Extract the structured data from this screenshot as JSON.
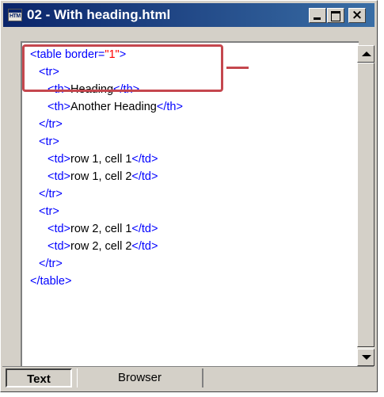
{
  "window": {
    "title": "02 - With heading.html",
    "icon_text": "HTM",
    "icon": "html-file-icon",
    "controls": [
      "minimize-icon",
      "maximize-icon",
      "close-icon"
    ]
  },
  "colors": {
    "titlebar": "#0a246a",
    "tag": "#0000ff",
    "attribute_value": "#ff0000",
    "highlight": "#c5474e"
  },
  "code": {
    "line1": {
      "tag": "<table border=",
      "attr": "\"1\"",
      "end": ">"
    },
    "line2": {
      "tag": "<tr>"
    },
    "line3": {
      "open": "<th>",
      "text": "Heading",
      "close": "</th>"
    },
    "line4": {
      "open": "<th>",
      "text": "Another Heading",
      "close": "</th>"
    },
    "line5": {
      "tag": "</tr>"
    },
    "line6": {
      "tag": "<tr>"
    },
    "line7": {
      "open": "<td>",
      "text": "row 1, cell 1",
      "close": "</td>"
    },
    "line8": {
      "open": "<td>",
      "text": "row 1, cell 2",
      "close": "</td>"
    },
    "line9": {
      "tag": "</tr>"
    },
    "line10": {
      "tag": "<tr>"
    },
    "line11": {
      "open": "<td>",
      "text": "row 2, cell 1",
      "close": "</td>"
    },
    "line12": {
      "open": "<td>",
      "text": "row 2, cell 2",
      "close": "</td>"
    },
    "line13": {
      "tag": "</tr>"
    },
    "line14": {
      "tag": "</table>"
    }
  },
  "tabs": {
    "text": "Text",
    "browser": "Browser",
    "active": "Text"
  }
}
